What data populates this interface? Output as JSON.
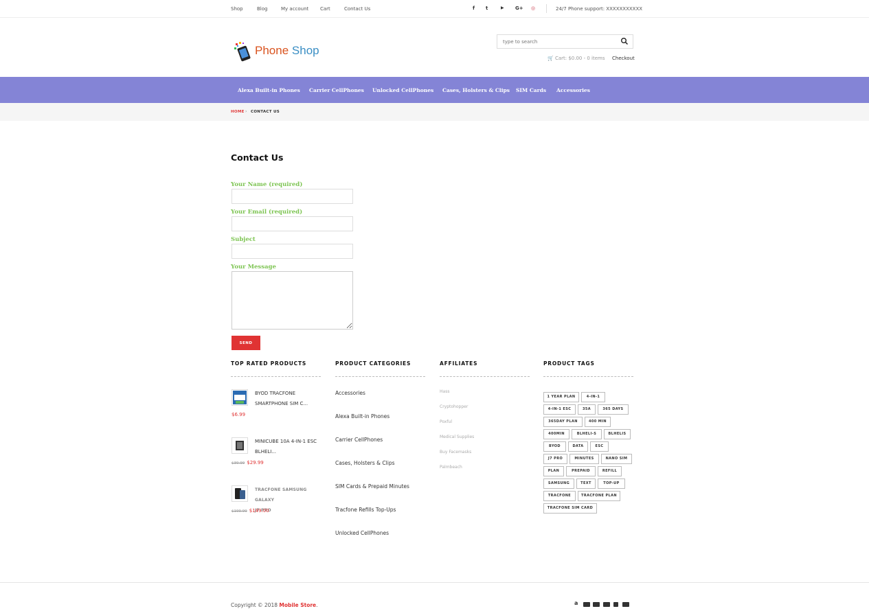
{
  "topbar": {
    "links": [
      "Shop",
      "Blog",
      "My account",
      "Cart",
      "Contact Us"
    ],
    "social": [
      "f",
      "t",
      "▶",
      "G+",
      "◎"
    ],
    "phone_support": "24/7 Phone support: XXXXXXXXXXX"
  },
  "header": {
    "logo_part1": "Phone",
    "logo_part2": "Shop",
    "search_placeholder": "type to search",
    "cart": "Cart: $0.00 - 0 items",
    "checkout": "Checkout"
  },
  "nav": {
    "items": [
      "Alexa Built-in Phones",
      "Carrier CellPhones",
      "Unlocked CellPhones",
      "Cases, Holsters & Clips",
      "SIM Cards",
      "Accessories"
    ]
  },
  "breadcrumb": {
    "home": "HOME",
    "separator": "›",
    "current": "CONTACT US"
  },
  "form": {
    "title": "Contact Us",
    "labels": [
      "Your Name (required)",
      "Your Email (required)",
      "Subject",
      "Your Message"
    ],
    "send_label": "SEND"
  },
  "footer": {
    "top_rated_title": "TOP RATED PRODUCTS",
    "products": [
      {
        "name_line1": "BYOD TRACFONE",
        "name_line2": "SMARTPHONE SIM C...",
        "old_price": "",
        "price": "$6.99"
      },
      {
        "name_line1": "MINICUBE 10A 4-IN-1 ESC",
        "name_line2": "BLHELI...",
        "old_price": "$39.99",
        "price": "$29.99"
      },
      {
        "name_line1": "TRACFONE SAMSUNG GALAXY",
        "name_line2": "J7 PRO",
        "old_price": "$199.99",
        "price": "$149.00"
      }
    ],
    "categories_title": "PRODUCT CATEGORIES",
    "categories": [
      "Accessories",
      "Alexa Built-in Phones",
      "Carrier CellPhones",
      "Cases, Holsters & Clips",
      "SIM Cards & Prepaid Minutes",
      "Tracfone Refills Top-Ups",
      "Unlocked CellPhones"
    ],
    "affiliates_title": "AFFILIATES",
    "affiliates": [
      "Hass",
      "Cryptohopper",
      "Poxful",
      "Medical Supplies",
      "Buy Facemasks",
      "Palmbeach"
    ],
    "tags_title": "PRODUCT TAGS",
    "tags": [
      "1 YEAR PLAN",
      "4-IN-1",
      "4-IN-1 ESC",
      "35A",
      "365 DAYS",
      "365DAY PLAN",
      "400 MIN",
      "400MIN",
      "BLHELI-S",
      "BLHELIS",
      "BYOD",
      "DATA",
      "ESC",
      "J7 PRO",
      "MINUTES",
      "NANO SIM",
      "PLAN",
      "PREPAID",
      "REFILL",
      "SAMSUNG",
      "TEXT",
      "TOP-UP",
      "TRACFONE",
      "TRACFONE PLAN",
      "TRACFONE SIM CARD"
    ]
  },
  "bottom": {
    "copyright_prefix": "Copyright © 2018 ",
    "brand": "Mobile Store",
    "copyright_suffix": "."
  },
  "colors": {
    "nav_bg": "#8484d6",
    "accent_red": "#e03333",
    "label_green": "#7dc452"
  }
}
